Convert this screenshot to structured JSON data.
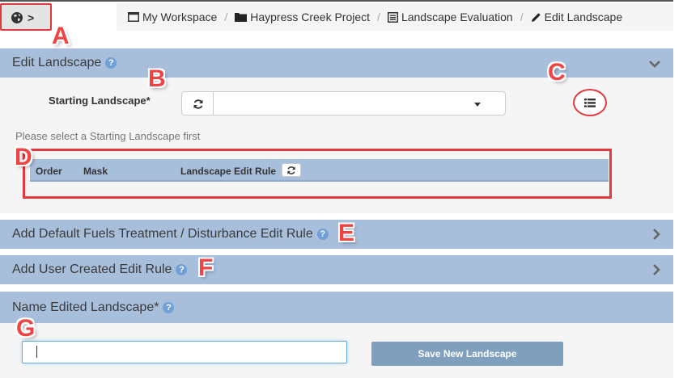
{
  "breadcrumb": [
    {
      "label": "My Workspace",
      "icon": "window-icon"
    },
    {
      "label": "Haypress Creek Project",
      "icon": "folder-icon"
    },
    {
      "label": "Landscape Evaluation",
      "icon": "list-icon"
    },
    {
      "label": "Edit Landscape",
      "icon": "pencil-icon"
    }
  ],
  "breadcrumb_separator": "/",
  "panels": {
    "edit_landscape": {
      "title": "Edit Landscape"
    },
    "default_rule": {
      "title": "Add Default Fuels Treatment / Disturbance Edit Rule"
    },
    "user_rule": {
      "title": "Add User Created Edit Rule"
    },
    "name_landscape": {
      "title": "Name Edited Landscape*"
    }
  },
  "help_glyph": "?",
  "starting_landscape": {
    "label": "Starting Landscape*",
    "selected": "",
    "hint": "Please select a Starting Landscape first"
  },
  "table": {
    "columns": [
      "Order",
      "Mask",
      "Landscape Edit Rule"
    ],
    "rows": []
  },
  "name_input": {
    "value": ""
  },
  "save_button": {
    "label": "Save New Landscape"
  },
  "annotations": [
    "A",
    "B",
    "C",
    "D",
    "E",
    "F",
    "G"
  ],
  "colors": {
    "panel_header": "#a8bfdc",
    "panel_body": "#f5f5f5",
    "save_button": "#7f9fbd",
    "annotation": "#ef4444",
    "help_badge": "#6fa0d8"
  }
}
